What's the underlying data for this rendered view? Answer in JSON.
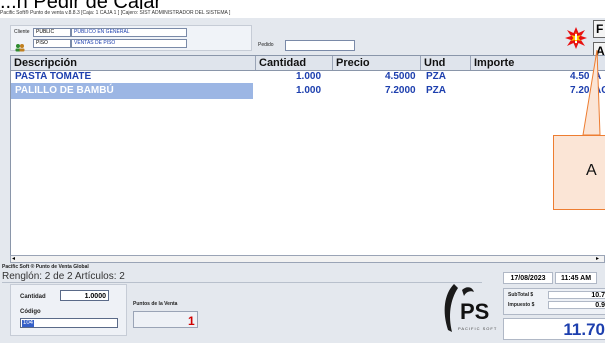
{
  "slide": {
    "title": "...n Pedir de Cajar"
  },
  "window": {
    "title": "Pacific Soft® Punto de venta  v.8.8.3   [Caja: 1 CAJA 1 ]   [Cajero: SIST  ADMINISTRADOR DEL SISTEMA ]"
  },
  "customer": {
    "cliente_label": "Cliente",
    "cliente_code": "PUBLIC",
    "cliente_name": "PUBLICO EN GENERAL",
    "piso_code": "PISO",
    "piso_name": "VENTAS DE PISO",
    "pedido_label": "Pedido",
    "pedido_value": ""
  },
  "right_buttons": {
    "f_label": "F",
    "a_label": "A"
  },
  "grid": {
    "columns": [
      "Descripción",
      "Cantidad",
      "Precio",
      "Und",
      "Importe"
    ],
    "rows": [
      {
        "descripcion": "PASTA TOMATE",
        "cantidad": "1.000",
        "precio": "4.5000",
        "und": "PZA",
        "importe": "4.50",
        "extra": "A"
      },
      {
        "descripcion": "PALILLO DE BAMBÚ",
        "cantidad": "1.000",
        "precio": "7.2000",
        "und": "PZA",
        "importe": "7.20",
        "extra": "AC"
      }
    ]
  },
  "footer": {
    "app_name": "Pacific Soft ® Punto de Venta Global",
    "status": "Renglón: 2 de 2   Artículos: 2",
    "cantidad_label": "Cantidad",
    "cantidad_value": "1.0000",
    "codigo_label": "Código",
    "codigo_value": "104",
    "puntos_label": "Puntos de la Venta",
    "puntos_value": "1",
    "logo_text": "PS",
    "logo_sub": "PACIFIC SOFT",
    "date": "17/08/2023",
    "time": "11:45 AM",
    "subtotal_label": "SubTotal $",
    "subtotal_value": "10.7",
    "impuesto_label": "Impuesto $",
    "impuesto_value": "0.9",
    "total_value": "11.70"
  },
  "callout": {
    "text": "A"
  },
  "colors": {
    "accent_blue": "#1d3fae",
    "selected_row": "#9cb6e4",
    "callout_fill": "#fbe5d6",
    "callout_border": "#ed7d31",
    "puntos_red": "#d00000",
    "alert_burst": "#e81010"
  }
}
